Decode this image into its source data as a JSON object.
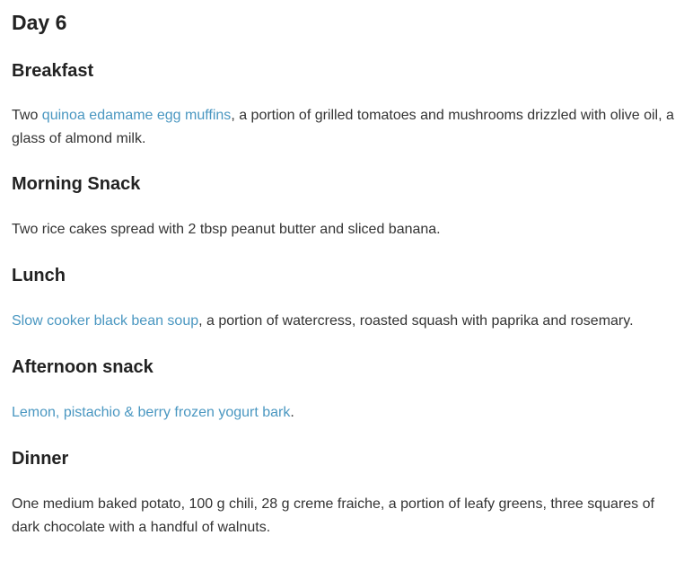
{
  "day_title": "Day 6",
  "colors": {
    "link": "#4a97c1",
    "heading": "#222222",
    "text": "#333333"
  },
  "breakfast": {
    "heading": "Breakfast",
    "prefix": "Two ",
    "link": "quinoa edamame egg muffins",
    "suffix": ", a portion of grilled tomatoes and mushrooms drizzled with olive oil, a glass of almond milk."
  },
  "morning_snack": {
    "heading": "Morning Snack",
    "text": "Two rice cakes spread with 2 tbsp peanut butter and sliced banana."
  },
  "lunch": {
    "heading": "Lunch",
    "link": "Slow cooker black bean soup",
    "suffix": ", a portion of watercress, roasted squash with paprika and rosemary."
  },
  "afternoon_snack": {
    "heading": "Afternoon snack",
    "link": "Lemon, pistachio & berry frozen yogurt bark",
    "suffix": "."
  },
  "dinner": {
    "heading": "Dinner",
    "text": "One medium baked potato, 100 g chili, 28 g creme fraiche, a portion of leafy greens, three squares of dark chocolate with a handful of walnuts."
  }
}
